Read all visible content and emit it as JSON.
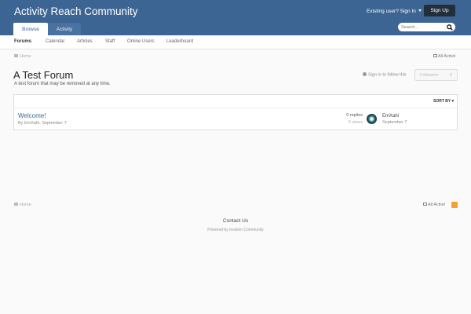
{
  "header": {
    "site_title": "Activity Reach Community",
    "signin_label": "Existing user? Sign In",
    "signup_label": "Sign Up",
    "tabs": [
      {
        "label": "Browse"
      },
      {
        "label": "Activity"
      }
    ],
    "search_placeholder": "Search..."
  },
  "subnav": {
    "items": [
      {
        "label": "Forums"
      },
      {
        "label": "Calendar"
      },
      {
        "label": "Articles"
      },
      {
        "label": "Staff"
      },
      {
        "label": "Online Users"
      },
      {
        "label": "Leaderboard"
      }
    ]
  },
  "breadcrumb": {
    "home": "Home",
    "all_activity": "All Activit"
  },
  "forum": {
    "title": "A Test Forum",
    "description": "A test forum that may be removed at any time.",
    "follow_text": "Sign in to follow this",
    "followers_label": "Followers",
    "followers_count": "0"
  },
  "panel": {
    "sort_label": "SORT BY"
  },
  "topics": [
    {
      "title": "Welcome!",
      "meta": "By EmXahi, September 7",
      "replies": "0 replies",
      "views": "0 views",
      "last_user": "EmXahi",
      "last_date": "September 7"
    }
  ],
  "footer": {
    "home": "Home",
    "all_activity": "All Activit",
    "contact": "Contact Us",
    "powered": "Powered by Invision Community"
  },
  "colors": {
    "header_bg": "#3d6594",
    "signup_bg": "#232e3b",
    "link": "#3d6594",
    "rss": "#f4a033"
  }
}
